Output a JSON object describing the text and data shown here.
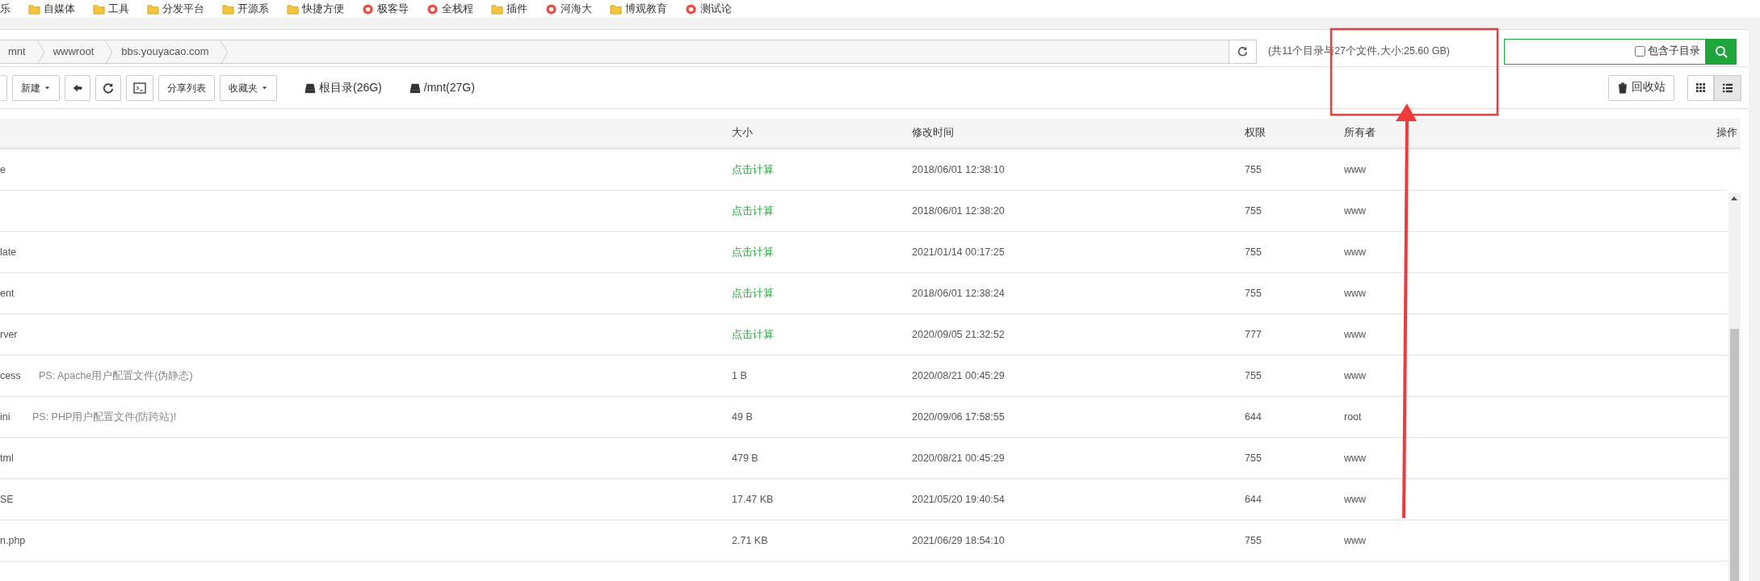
{
  "bookmarks": [
    {
      "label": "乐",
      "kind": "none"
    },
    {
      "label": "自媒体",
      "kind": "folder"
    },
    {
      "label": "工具",
      "kind": "folder"
    },
    {
      "label": "分发平台",
      "kind": "folder"
    },
    {
      "label": "开源系",
      "kind": "folder"
    },
    {
      "label": "快捷方便",
      "kind": "folder"
    },
    {
      "label": "极客导",
      "kind": "site"
    },
    {
      "label": "全栈程",
      "kind": "site"
    },
    {
      "label": "插件",
      "kind": "folder"
    },
    {
      "label": "河海大",
      "kind": "site"
    },
    {
      "label": "博观教育",
      "kind": "folder"
    },
    {
      "label": "测试论",
      "kind": "site"
    }
  ],
  "breadcrumb": [
    "mnt",
    "wwwroot",
    "bbs.youyacao.com"
  ],
  "summary": "(共11个目录与27个文件,大小:25.60 GB)",
  "search": {
    "subdir_label": "包含子目录",
    "subdir_checked": false
  },
  "toolbar": [
    {
      "label": "新建",
      "kind": "dropdown"
    },
    {
      "kind": "back"
    },
    {
      "kind": "refresh"
    },
    {
      "kind": "terminal"
    },
    {
      "label": "分享列表",
      "kind": "text"
    },
    {
      "label": "收藏夹",
      "kind": "dropdown"
    }
  ],
  "disks": [
    "根目录(26G)",
    "/mnt(27G)"
  ],
  "recycle": "回收站",
  "views": [
    {
      "kind": "grid",
      "selected": false
    },
    {
      "kind": "list",
      "selected": true
    }
  ],
  "table": {
    "columns": [
      "大小",
      "修改时间",
      "权限",
      "所有者",
      "操作"
    ],
    "rows": [
      {
        "name": "e",
        "kind": "folder",
        "size": "点击计算",
        "modified": "2018/06/01 12:38:10",
        "perm": "755",
        "owner": "www"
      },
      {
        "kind": "folder",
        "size": "点击计算",
        "modified": "2018/06/01 12:38:20",
        "perm": "755",
        "owner": "www"
      },
      {
        "name": "late",
        "kind": "folder",
        "size": "点击计算",
        "modified": "2021/01/14 00:17:25",
        "perm": "755",
        "owner": "www"
      },
      {
        "name": "ent",
        "kind": "folder",
        "size": "点击计算",
        "modified": "2018/06/01 12:38:24",
        "perm": "755",
        "owner": "www"
      },
      {
        "name": "rver",
        "kind": "folder",
        "size": "点击计算",
        "modified": "2020/09/05 21:32:52",
        "perm": "777",
        "owner": "www"
      },
      {
        "name": "cess",
        "note": "PS: Apache用户配置文件(伪静态)",
        "kind": "file",
        "size": "1 B",
        "modified": "2020/08/21 00:45:29",
        "perm": "755",
        "owner": "www"
      },
      {
        "name": "ini",
        "note": "PS: PHP用户配置文件(防跨站)!",
        "kind": "file",
        "size": "49 B",
        "modified": "2020/09/06 17:58:55",
        "perm": "644",
        "owner": "root"
      },
      {
        "name": "tml",
        "kind": "file",
        "size": "479 B",
        "modified": "2020/08/21 00:45:29",
        "perm": "755",
        "owner": "www"
      },
      {
        "name": "SE",
        "kind": "file",
        "size": "17.47 KB",
        "modified": "2021/05/20 19:40:54",
        "perm": "644",
        "owner": "www"
      },
      {
        "name": "n.php",
        "kind": "file",
        "size": "2.71 KB",
        "modified": "2021/06/29 18:54:10",
        "perm": "755",
        "owner": "www"
      }
    ]
  }
}
